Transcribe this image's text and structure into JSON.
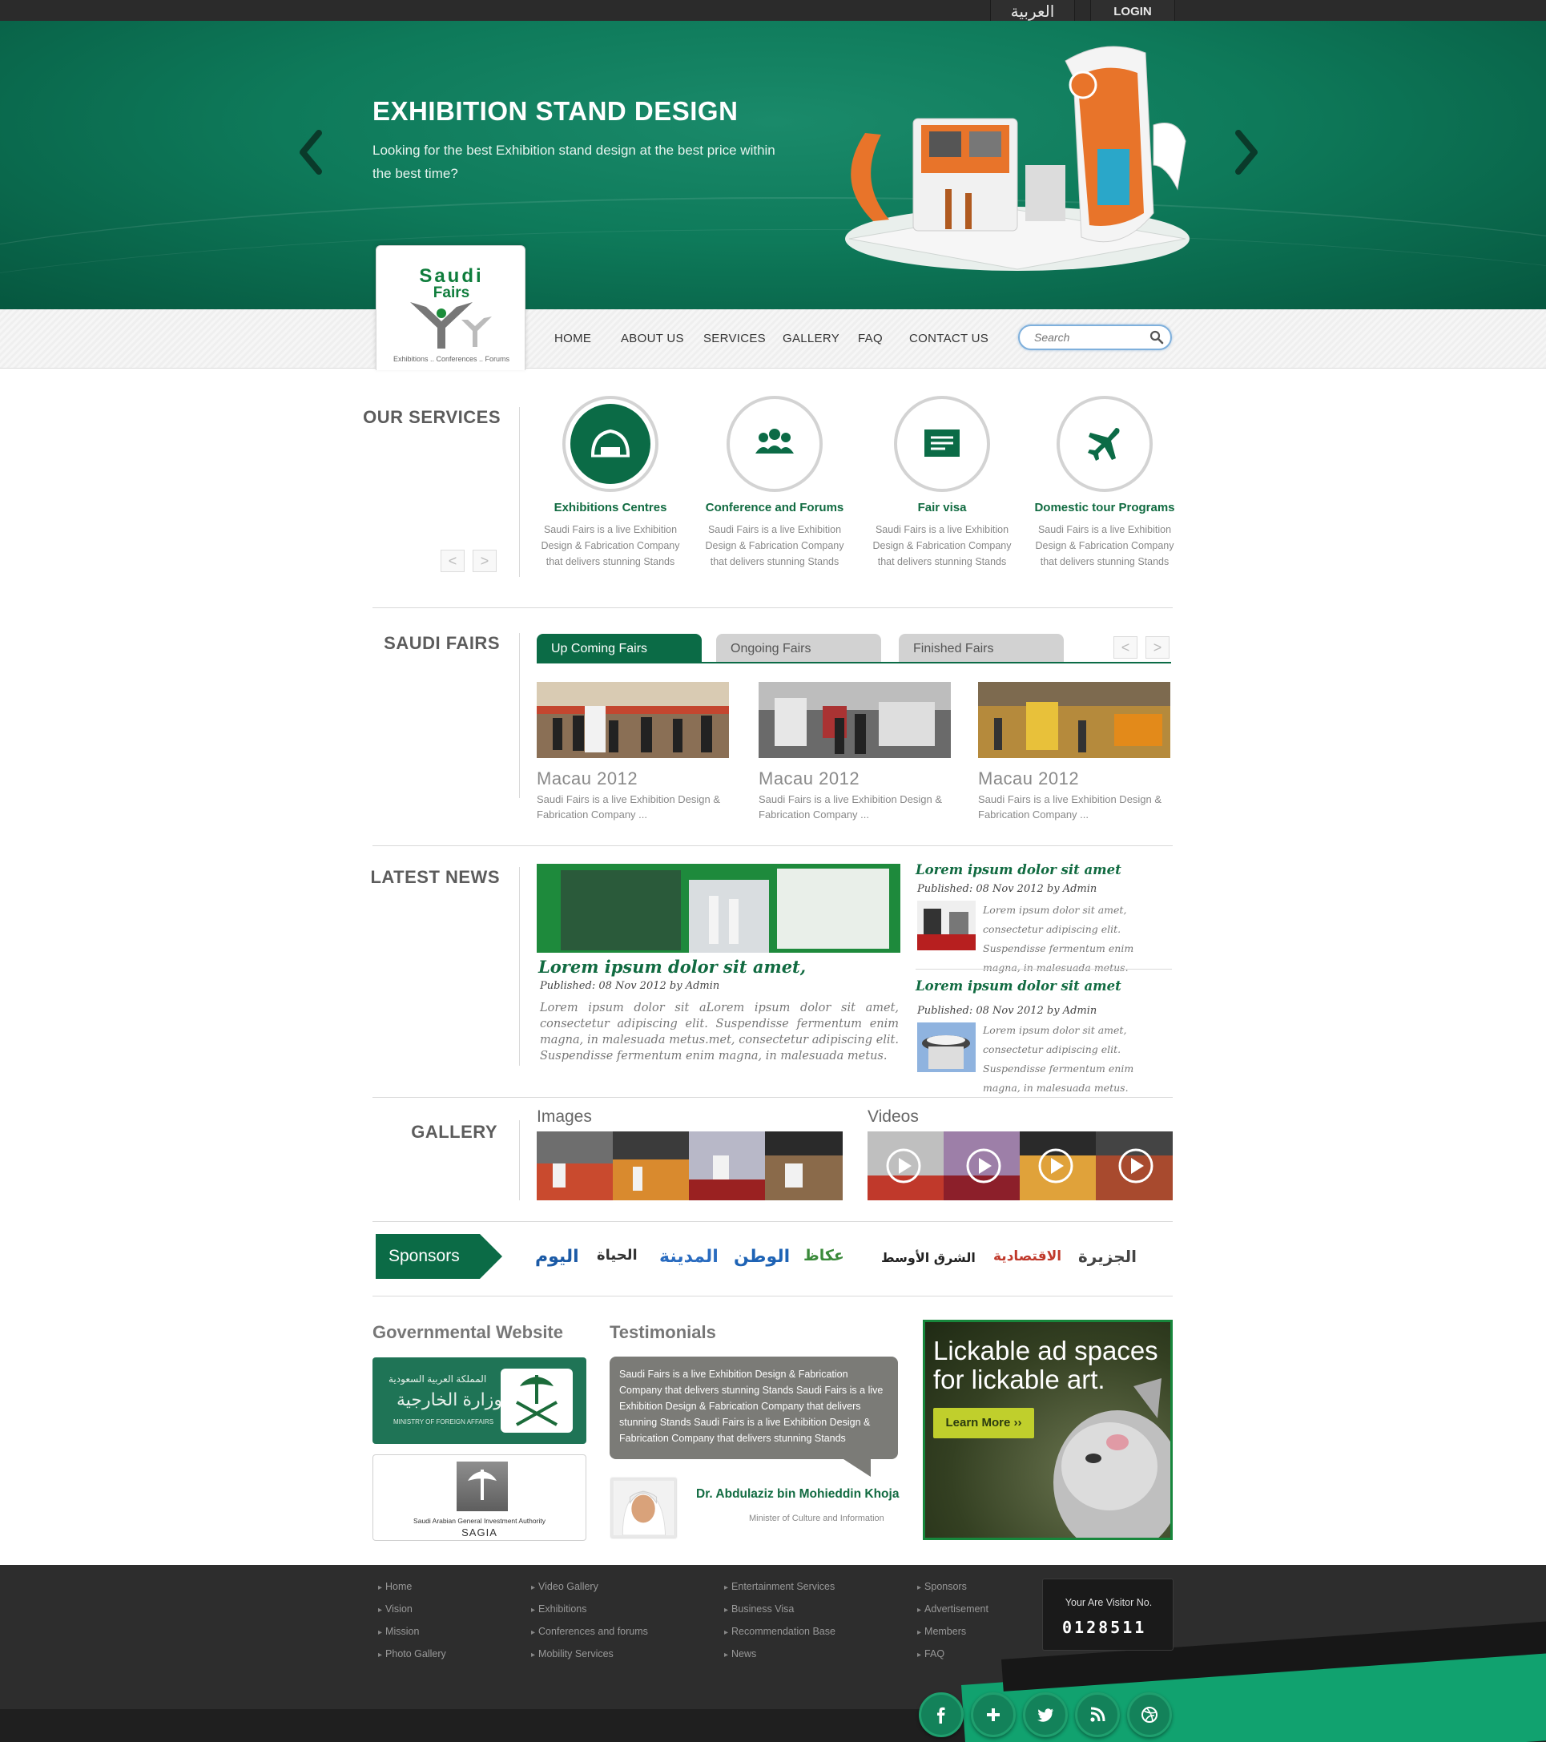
{
  "topbar": {
    "arabic_label": "العربية",
    "login_label": "LOGIN"
  },
  "hero": {
    "title": "EXHIBITION STAND DESIGN",
    "subtitle": "Looking for the best Exhibition stand design at the best price within the best time?"
  },
  "logo": {
    "line1": "Saudi",
    "line2": "Fairs",
    "tagline": "Exhibitions .. Conferences .. Forums"
  },
  "nav": {
    "items": [
      "HOME",
      "ABOUT US",
      "SERVICES",
      "GALLERY",
      "FAQ",
      "CONTACT US"
    ],
    "search_placeholder": "Search"
  },
  "services": {
    "title": "OUR SERVICES",
    "prev": "<",
    "next": ">",
    "items": [
      {
        "name": "Exhibitions Centres",
        "desc": "Saudi Fairs is a live Exhibition Design & Fabrication Company that delivers stunning Stands",
        "icon": "arena-icon"
      },
      {
        "name": "Conference and Forums",
        "desc": "Saudi Fairs is a live Exhibition Design & Fabrication Company that delivers stunning Stands",
        "icon": "people-icon"
      },
      {
        "name": "Fair visa",
        "desc": "Saudi Fairs is a live Exhibition Design & Fabrication Company that delivers stunning Stands",
        "icon": "document-icon"
      },
      {
        "name": "Domestic tour Programs",
        "desc": "Saudi Fairs is a live Exhibition Design & Fabrication Company that delivers stunning Stands",
        "icon": "airplane-icon"
      }
    ]
  },
  "fairs": {
    "title": "SAUDI FAIRS",
    "tabs": [
      "Up Coming Fairs",
      "Ongoing Fairs",
      "Finished Fairs"
    ],
    "prev": "<",
    "next": ">",
    "items": [
      {
        "title": "Macau 2012",
        "desc": "Saudi Fairs is a live Exhibition Design & Fabrication Company ..."
      },
      {
        "title": "Macau 2012",
        "desc": "Saudi Fairs is a live Exhibition Design & Fabrication Company ..."
      },
      {
        "title": "Macau 2012",
        "desc": "Saudi Fairs is a live Exhibition Design & Fabrication Company ..."
      }
    ]
  },
  "news": {
    "title": "LATEST NEWS",
    "main": {
      "title": "Lorem ipsum dolor sit amet,",
      "meta": "Published: 08 Nov 2012  by  Admin",
      "body": "Lorem ipsum dolor sit aLorem ipsum dolor sit amet, consectetur adipiscing elit. Suspendisse fermentum enim magna, in malesuada metus.met, consectetur adipiscing elit. Suspendisse fermentum enim magna, in malesuada metus."
    },
    "side": [
      {
        "title": "Lorem ipsum dolor sit amet",
        "meta": "Published: 08 Nov 2012  by  Admin",
        "body": "Lorem ipsum dolor sit amet, consectetur adipiscing elit. Suspendisse fermentum enim magna, in malesuada metus."
      },
      {
        "title": "Lorem ipsum dolor sit amet",
        "meta": "Published: 08 Nov 2012  by  Admin",
        "body": "Lorem ipsum dolor sit amet, consectetur adipiscing elit. Suspendisse fermentum enim magna, in malesuada metus."
      }
    ]
  },
  "gallery": {
    "title": "GALLERY",
    "images_label": "Images",
    "videos_label": "Videos"
  },
  "sponsors": {
    "label": "Sponsors",
    "logos": [
      {
        "text": "اليوم",
        "color": "#1b5aa6"
      },
      {
        "text": "الحياة",
        "color": "#333333"
      },
      {
        "text": "المدينة",
        "color": "#2a6cc0"
      },
      {
        "text": "الوطن",
        "color": "#1e63b5"
      },
      {
        "text": "عكاظ",
        "color": "#3a8a3a"
      },
      {
        "text": "الشرق الأوسط",
        "color": "#222222"
      },
      {
        "text": "الاقتصادية",
        "color": "#c0392b"
      },
      {
        "text": "الجزيرة",
        "color": "#444444"
      }
    ]
  },
  "bottom": {
    "gov_title": "Governmental Website",
    "gov1_line1": "المملكة العربية السعودية",
    "gov1_line2": "وزارة الخارجية",
    "gov1_line3": "MINISTRY OF FOREIGN AFFAIRS",
    "gov2_line1": "Saudi Arabian General Investment Authority",
    "gov2_line2": "SAGIA",
    "testimonials_title": "Testimonials",
    "testimonial_text": "Saudi Fairs is a live Exhibition Design & Fabrication Company that delivers stunning Stands Saudi Fairs is a live Exhibition Design & Fabrication Company that delivers stunning Stands Saudi Fairs is a live Exhibition Design & Fabrication Company that delivers stunning Stands",
    "testimonial_name": "Dr. Abdulaziz bin Mohieddin Khoja",
    "testimonial_role": "Minister of Culture and Information",
    "ad_headline": "Lickable ad spaces for lickable art.",
    "ad_button": "Learn More ››"
  },
  "footer": {
    "col1": [
      "Home",
      "Vision",
      "Mission",
      "Photo Gallery"
    ],
    "col2": [
      "Video Gallery",
      "Exhibitions",
      "Conferences and forums",
      "Mobility Services"
    ],
    "col3": [
      "Entertainment Services",
      "Business Visa",
      "Recommendation Base",
      "News"
    ],
    "col4": [
      "Sponsors",
      "Advertisement",
      "Members",
      "FAQ"
    ],
    "visitor_label": "Your Are Visitor No.",
    "visitor_number": "0128511",
    "social": [
      "facebook-icon",
      "plus-icon",
      "twitter-icon",
      "rss-icon",
      "dribbble-icon"
    ]
  },
  "colors": {
    "brand_green": "#0b6b46",
    "hero_green": "#0e7a5a",
    "footer_dark": "#2d2d2d",
    "accent_teal": "#11a26f"
  }
}
